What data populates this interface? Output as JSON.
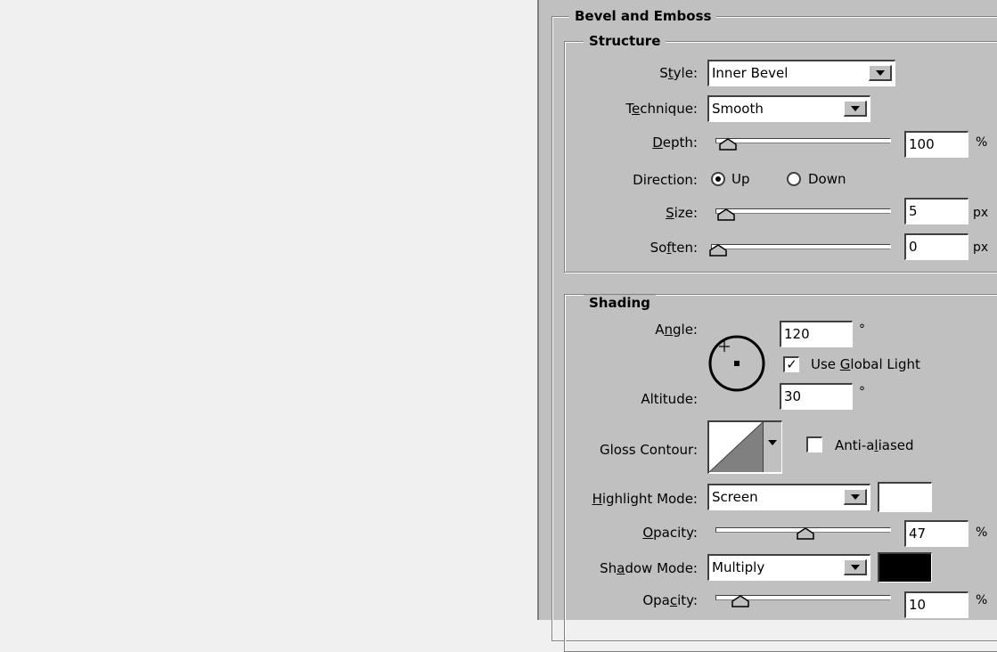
{
  "bevel": {
    "title": "Bevel and Emboss",
    "structure": {
      "title": "Structure",
      "style": {
        "label": "Style:",
        "value": "Inner Bevel"
      },
      "technique": {
        "label": "Technique:",
        "value": "Smooth"
      },
      "depth": {
        "label": "Depth:",
        "value": "100",
        "unit": "%",
        "level": 0.03
      },
      "direction": {
        "label": "Direction:",
        "options": [
          "Up",
          "Down"
        ],
        "selected": "Up"
      },
      "size": {
        "label": "Size:",
        "value": "5",
        "unit": "px",
        "level": 0.02
      },
      "soften": {
        "label": "Soften:",
        "value": "0",
        "unit": "px",
        "level": 0.0
      }
    },
    "shading": {
      "title": "Shading",
      "angle": {
        "label": "Angle:",
        "value": "120",
        "unit": "°"
      },
      "use_global_light": {
        "label": "Use Global Light",
        "checked": true
      },
      "altitude": {
        "label": "Altitude:",
        "value": "30",
        "unit": "°"
      },
      "gloss_contour": {
        "label": "Gloss Contour:"
      },
      "anti_aliased": {
        "label": "Anti-aliased",
        "checked": false
      },
      "highlight_mode": {
        "label": "Highlight Mode:",
        "value": "Screen",
        "color": "#ffffff"
      },
      "highlight_opacity": {
        "label": "Opacity:",
        "value": "47",
        "unit": "%",
        "level": 0.47
      },
      "shadow_mode": {
        "label": "Shadow Mode:",
        "value": "Multiply",
        "color": "#000000"
      },
      "shadow_opacity": {
        "label": "Opacity:",
        "value": "10",
        "unit": "%",
        "level": 0.1
      }
    }
  }
}
